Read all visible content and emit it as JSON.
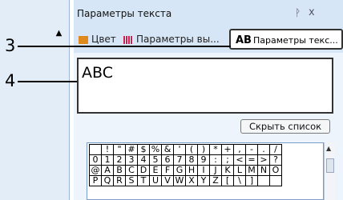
{
  "panel": {
    "title": "Параметры текста",
    "pin_icon": "pin-icon",
    "close_label": "x"
  },
  "callouts": {
    "c3": "3",
    "c4": "4"
  },
  "tabs": [
    {
      "label": "Цвет",
      "icon": "color-icon",
      "color": "#e08a1e"
    },
    {
      "label": "Параметры вы...",
      "icon": "stitch-icon",
      "color": "#d11d52"
    },
    {
      "label": "Параметры текс...",
      "icon_text": "AB"
    }
  ],
  "text_input": {
    "value": "ABC"
  },
  "hide_list_button": "Скрыть список",
  "char_grid": [
    [
      "",
      "!",
      "\"",
      "#",
      "$",
      "%",
      "&",
      "'",
      "(",
      ")",
      "*",
      "+",
      ",",
      "-",
      ".",
      "/"
    ],
    [
      "0",
      "1",
      "2",
      "3",
      "4",
      "5",
      "6",
      "7",
      "8",
      "9",
      ":",
      ";",
      "<",
      "=",
      ">",
      "?"
    ],
    [
      "@",
      "A",
      "B",
      "C",
      "D",
      "E",
      "F",
      "G",
      "H",
      "I",
      "J",
      "K",
      "L",
      "M",
      "N",
      "O"
    ],
    [
      "P",
      "Q",
      "R",
      "S",
      "T",
      "U",
      "V",
      "W",
      "X",
      "Y",
      "Z",
      "[",
      "\\",
      "]",
      "",
      ""
    ]
  ]
}
